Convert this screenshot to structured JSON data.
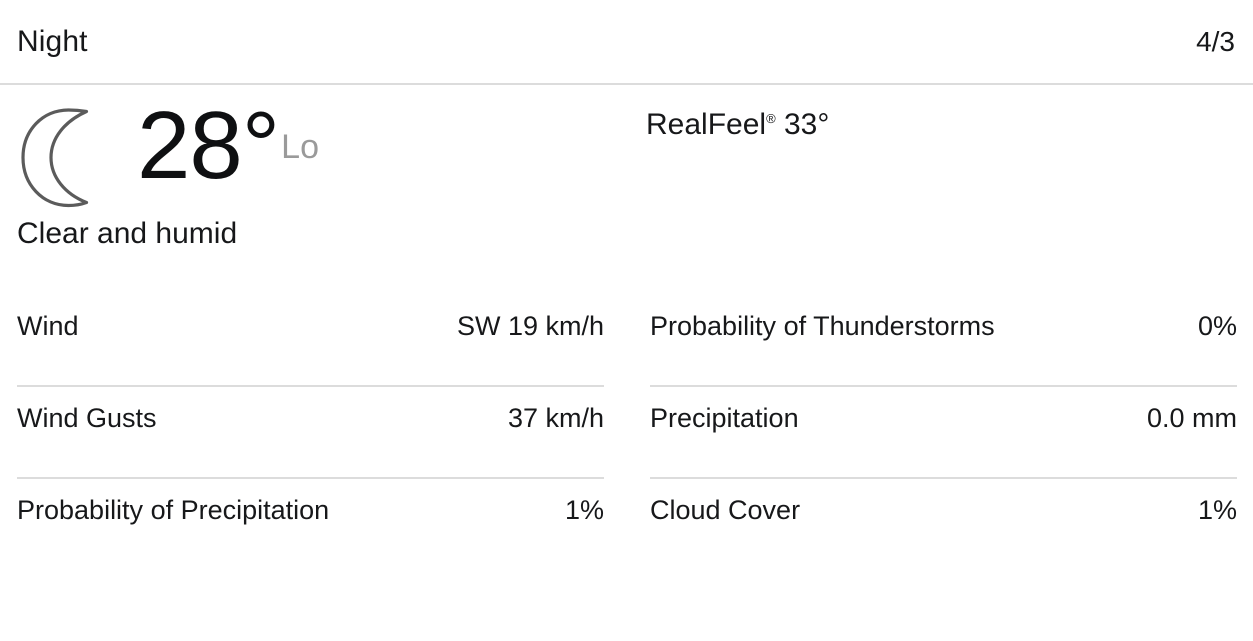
{
  "header": {
    "period": "Night",
    "date": "4/3"
  },
  "summary": {
    "icon": "crescent-moon-icon",
    "temperature": "28°",
    "temperature_qualifier": "Lo",
    "realfeel_label": "RealFeel",
    "realfeel_trademark": "®",
    "realfeel_value": "33°",
    "phrase": "Clear and humid"
  },
  "details": {
    "left": [
      {
        "label": "Wind",
        "value": "SW 19 km/h"
      },
      {
        "label": "Wind Gusts",
        "value": "37 km/h"
      },
      {
        "label": "Probability of Precipitation",
        "value": "1%"
      }
    ],
    "right": [
      {
        "label": "Probability of Thunderstorms",
        "value": "0%"
      },
      {
        "label": "Precipitation",
        "value": "0.0 mm"
      },
      {
        "label": "Cloud Cover",
        "value": "1%"
      }
    ]
  },
  "colors": {
    "text": "#17181a",
    "muted": "#9a9a9a",
    "divider": "#dcdcdc",
    "icon_stroke": "#5b5b5b",
    "background": "#ffffff"
  }
}
